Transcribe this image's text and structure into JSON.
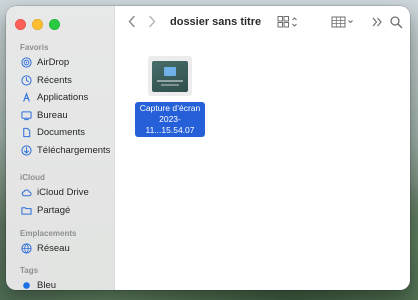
{
  "window": {
    "title": "dossier sans titre"
  },
  "sidebar": {
    "favoris_header": "Favoris",
    "favoris": [
      {
        "label": "AirDrop",
        "icon": "airdrop-icon"
      },
      {
        "label": "Récents",
        "icon": "clock-icon"
      },
      {
        "label": "Applications",
        "icon": "applications-icon"
      },
      {
        "label": "Bureau",
        "icon": "desktop-icon"
      },
      {
        "label": "Documents",
        "icon": "document-icon"
      },
      {
        "label": "Téléchargements",
        "icon": "download-icon"
      }
    ],
    "icloud_header": "iCloud",
    "icloud": [
      {
        "label": "iCloud Drive",
        "icon": "cloud-icon"
      },
      {
        "label": "Partagé",
        "icon": "shared-folder-icon"
      }
    ],
    "emplacements_header": "Emplacements",
    "emplacements": [
      {
        "label": "Réseau",
        "icon": "network-icon"
      }
    ],
    "tags_header": "Tags",
    "tags": [
      {
        "label": "Bleu",
        "color": "#1f6fe5"
      }
    ]
  },
  "files": [
    {
      "name_line1": "Capture d’écran",
      "name_line2": "2023-11...15.54.07",
      "selected": true
    }
  ],
  "colors": {
    "accent": "#2560d8",
    "sidebar_icon": "#2f6fdc"
  }
}
